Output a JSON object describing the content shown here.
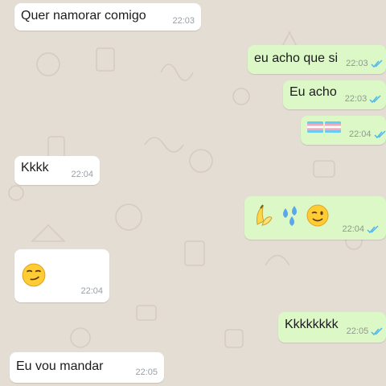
{
  "colors": {
    "incoming_bubble": "#ffffff",
    "outgoing_bubble": "#dcf8c6",
    "read_ticks": "#4fb6ec",
    "wallpaper": "#e4ddd3"
  },
  "messages": [
    {
      "dir": "in",
      "text": "Quer namorar comigo",
      "time": "22:03"
    },
    {
      "dir": "out",
      "text": "eu acho que si",
      "time": "22:03",
      "status": "read"
    },
    {
      "dir": "out",
      "text": "Eu acho",
      "time": "22:03",
      "status": "read"
    },
    {
      "dir": "out",
      "emoji": [
        "transgender-flag",
        "transgender-flag"
      ],
      "time": "22:04",
      "status": "read"
    },
    {
      "dir": "in",
      "text": "Kkkk",
      "time": "22:04"
    },
    {
      "dir": "out",
      "emoji": [
        "banana",
        "sweat-droplets",
        "winking-face"
      ],
      "time": "22:04",
      "status": "read"
    },
    {
      "dir": "in",
      "emoji": [
        "smirking-face"
      ],
      "time": "22:04"
    },
    {
      "dir": "out",
      "text": "Kkkkkkkk",
      "time": "22:05",
      "status": "read"
    },
    {
      "dir": "in",
      "text": "Eu vou mandar",
      "time": "22:05"
    }
  ]
}
